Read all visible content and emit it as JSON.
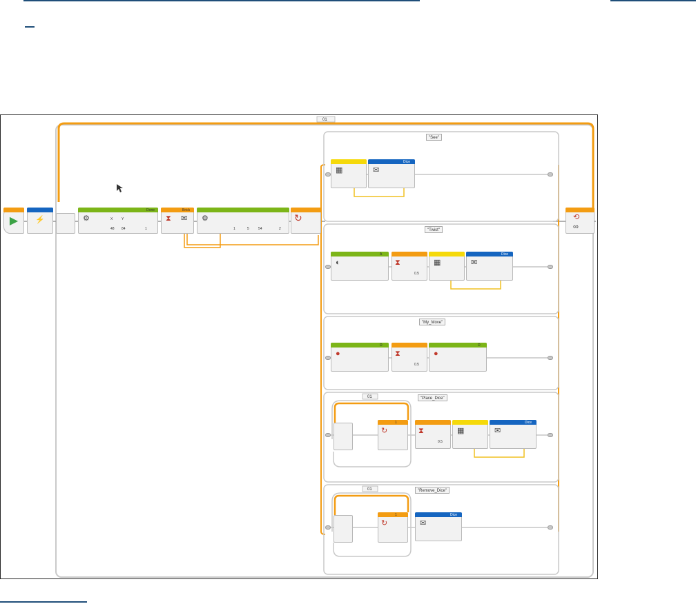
{
  "page": {
    "accent_link": "#1f4e79"
  },
  "program": {
    "outer_loop": {
      "label": "01",
      "color": "#f39c12"
    },
    "start_block": {
      "icon": "play-icon",
      "color": "#3ca346"
    },
    "sound_block": {
      "icon": "brick-sound-icon",
      "color": "#1565c0"
    },
    "display_block_1": {
      "mode": "Done",
      "color": "#7cb518",
      "fields": [
        "X",
        "Y",
        "48",
        "84",
        "1"
      ]
    },
    "wait_block": {
      "label": "Brick",
      "color": "#f39c12"
    },
    "display_block_2": {
      "color": "#7cb518",
      "fields": [
        "1",
        "5",
        "54",
        "2"
      ]
    },
    "switch_block": {
      "color": "#f39c12",
      "icon": "switch-icon"
    },
    "loop_end": {
      "icon": "infinity-icon",
      "color": "#f39c12"
    }
  },
  "cases": [
    {
      "label": "\"See\"",
      "blocks": [
        "Dice"
      ]
    },
    {
      "label": "\"Twist\"",
      "blocks": [
        "A",
        "0.5",
        "Dice"
      ]
    },
    {
      "label": "\"My_Move\"",
      "blocks": [
        "D",
        "0.5",
        "D"
      ]
    },
    {
      "label": "\"Place_Dice\"",
      "loop": "01",
      "blocks": [
        "1",
        "0.5",
        "Dice"
      ]
    },
    {
      "label": "\"Remove_Dice\"",
      "loop": "01",
      "blocks": [
        "1",
        "Dice"
      ]
    }
  ],
  "colors": {
    "orange": "#f39c12",
    "green": "#7cb518",
    "blue": "#1565c0",
    "yellow": "#f5d90a",
    "wire_yellow": "#f0c020",
    "frame_gray": "#c9c9c9"
  }
}
